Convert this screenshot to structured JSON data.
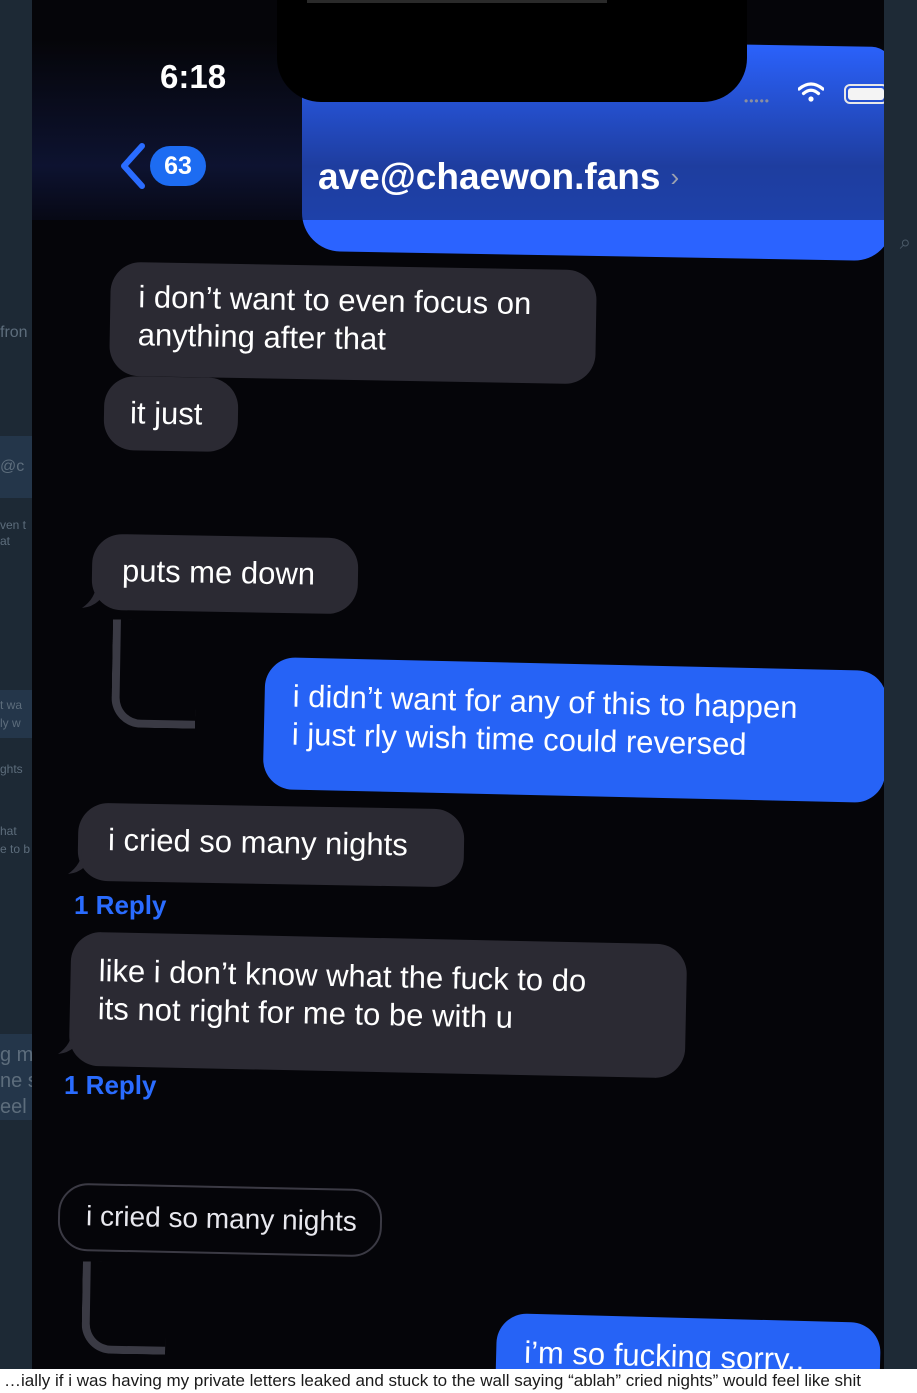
{
  "status_bar": {
    "time": "6:18",
    "signal": "•••••"
  },
  "header": {
    "back_count": "63",
    "contact_name": "ave@chaewon.fans",
    "contact_chevron": "›"
  },
  "messages": [
    {
      "direction": "incoming",
      "lines": [
        "i don’t want to even focus on",
        "anything after that"
      ]
    },
    {
      "direction": "incoming",
      "lines": [
        "it just"
      ]
    },
    {
      "direction": "incoming",
      "lines": [
        "puts me down"
      ]
    },
    {
      "direction": "outgoing",
      "lines": [
        "i didn’t want for any of this to happen",
        "i just rly wish time could reversed"
      ]
    },
    {
      "direction": "incoming",
      "lines": [
        "i cried so many nights"
      ],
      "reply_label": "1 Reply"
    },
    {
      "direction": "incoming",
      "lines": [
        "like i don’t know what the fuck to do",
        "its not right for me to be with u"
      ],
      "reply_label": "1 Reply"
    },
    {
      "direction": "incoming-quoted",
      "lines": [
        "i cried so many nights"
      ]
    },
    {
      "direction": "outgoing",
      "lines": [
        "i’m so fucking sorry,,"
      ]
    }
  ],
  "background_fragments": [
    "fron",
    "@c",
    "ven t",
    "at",
    "t wa",
    "ly w",
    "ghts",
    "hat",
    "e to b",
    "g m",
    "ne s",
    "eel"
  ],
  "bottom_caption": "…ially if i was having my private letters leaked and stuck to the wall saying “ablah” cried nights” would feel like shit",
  "colors": {
    "outgoing_bubble": "#2663f6",
    "incoming_bubble": "#2b2a33",
    "reply_link": "#2a6cff",
    "badge": "#1d6cf2"
  },
  "icons": {
    "back": "chevron-left-icon",
    "wifi": "wifi-icon",
    "battery": "battery-icon",
    "search": "search-icon"
  }
}
